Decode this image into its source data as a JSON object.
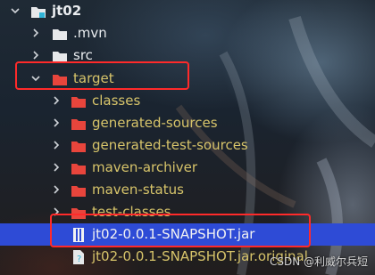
{
  "tree": {
    "items": [
      {
        "label": "jt02",
        "icon": "module-folder-icon"
      },
      {
        "label": ".mvn",
        "icon": "folder-icon"
      },
      {
        "label": "src",
        "icon": "folder-icon"
      },
      {
        "label": "target",
        "icon": "excluded-folder-icon"
      },
      {
        "label": "classes",
        "icon": "excluded-folder-icon"
      },
      {
        "label": "generated-sources",
        "icon": "excluded-folder-icon"
      },
      {
        "label": "generated-test-sources",
        "icon": "excluded-folder-icon"
      },
      {
        "label": "maven-archiver",
        "icon": "excluded-folder-icon"
      },
      {
        "label": "maven-status",
        "icon": "excluded-folder-icon"
      },
      {
        "label": "test-classes",
        "icon": "excluded-folder-icon"
      },
      {
        "label": "jt02-0.0.1-SNAPSHOT.jar",
        "icon": "jar-file-icon"
      },
      {
        "label": "jt02-0.0.1-SNAPSHOT.jar.original",
        "icon": "unknown-file-icon"
      }
    ],
    "selected": "jt02-0.0.1-SNAPSHOT.jar"
  },
  "colors": {
    "selection": "#2e4bd6",
    "excluded_label": "#d7c46a",
    "excluded_folder": "#e8453c",
    "highlight_box": "#ff2a2a"
  },
  "watermark": "CSDN @利威尔兵短"
}
